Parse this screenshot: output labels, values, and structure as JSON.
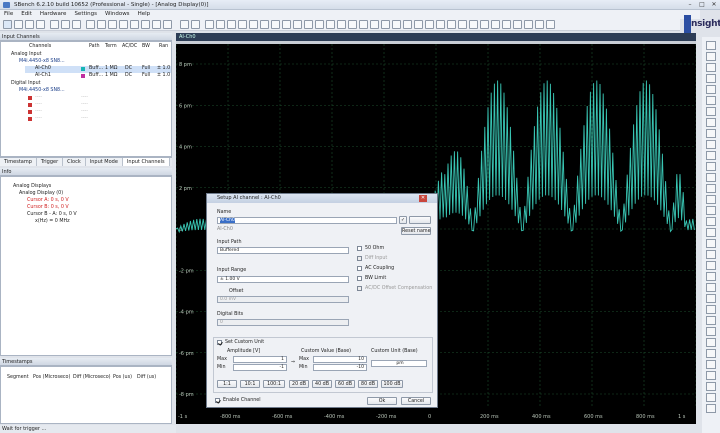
{
  "window": {
    "title": "SBench 6.2.10 build 10652 (Professional - Single) - [Analog Display(0)]",
    "min": "–",
    "max": "□",
    "close": "✕"
  },
  "menu": [
    "File",
    "Edit",
    "Hardware",
    "Settings",
    "Windows",
    "Help"
  ],
  "logo": {
    "text": "nsight"
  },
  "input_channels": {
    "header": "Input Channels",
    "columns": [
      "Channels",
      "Path",
      "Term",
      "AC/DC",
      "BW",
      "Ran"
    ],
    "rows": [
      {
        "name": "Analog Input"
      },
      {
        "name": "M4i.4450-x8 SN8..."
      },
      {
        "name": "AI-Ch0",
        "path": "Buff...",
        "term": "1 MΩ",
        "acdc": "DC",
        "bw": "Full",
        "range": "± 1.0"
      },
      {
        "name": "AI-Ch1",
        "path": "Buff...",
        "term": "1 MΩ",
        "acdc": "DC",
        "bw": "Full",
        "range": "± 1.0"
      },
      {
        "name": "Digital Input"
      },
      {
        "name": "M4i.4450-x8 SN8..."
      },
      {
        "name": "----",
        "dash": "----"
      },
      {
        "name": "----",
        "dash": "----"
      },
      {
        "name": "----",
        "dash": "----"
      },
      {
        "name": "----",
        "dash": "----"
      }
    ],
    "tabs": [
      "Timestamp",
      "Trigger",
      "Clock",
      "Input Mode",
      "Input Channels"
    ]
  },
  "info": {
    "header": "Info",
    "items": [
      "Analog Displays",
      "Analog Display (0)",
      "Cursor A: 0 s, 0 V",
      "Cursor B: 0 s, 0 V",
      "Cursor B - A: 0 s, 0 V",
      "x(Hz) = 0 MHz"
    ]
  },
  "timestamps": {
    "header": "Timestamps",
    "columns": [
      "Segment",
      "Pos (Microseco)",
      "Diff (Microseco)",
      "Pos (us)",
      "Diff (us)"
    ]
  },
  "status": "Wait for trigger ...",
  "plot": {
    "tab": "AI-Ch0",
    "y_ticks": [
      "8 pm",
      "6 pm",
      "4 pm",
      "2 pm",
      "0",
      "-2 pm",
      "-4 pm",
      "-6 pm",
      "-8 pm"
    ],
    "x_ticks": [
      "-1 s",
      "-800 ms",
      "-600 ms",
      "-400 ms",
      "-200 ms",
      "0",
      "200 ms",
      "400 ms",
      "600 ms",
      "800 ms",
      "1 s"
    ],
    "trace_color": "#39c6b4"
  },
  "dialog": {
    "title": "Setup AI channel : AI-Ch0",
    "name_label": "Name",
    "name_value": "AI-Ch0",
    "name_default": "AI-Ch0",
    "reset_name": "Reset name",
    "input_path_label": "Input Path",
    "input_path_value": "Buffered",
    "input_range_label": "Input Range",
    "input_range_value": "± 1.00 V",
    "offset_label": "Offset",
    "offset_value": "0.0 mV",
    "digital_bits_label": "Digital Bits",
    "digital_bits_value": "0",
    "ohm_label": "50 Ohm",
    "diff_label": "Diff Input",
    "ac_label": "AC Coupling",
    "bw_label": "BW Limit",
    "acdc_offset_label": "AC/DC Offset Compensation",
    "custom_unit_label": "Set Custom Unit",
    "amplitude_label": "Amplitude [V]",
    "custom_value_label": "Custom Value (Base)",
    "custom_unit_base_label": "Custom Unit (Base)",
    "max_label": "Max",
    "min_label": "Min",
    "amp_max": "1",
    "amp_min": "-1",
    "cv_max": "10",
    "cv_min": "-10",
    "arrow": "⇒",
    "unit_value": "pm",
    "scale_buttons": [
      "1:1",
      "10:1",
      "100:1",
      "20 dB",
      "40 dB",
      "60 dB",
      "80 dB",
      "100 dB"
    ],
    "enable_label": "Enable Channel",
    "ok": "Ok",
    "cancel": "Cancel"
  }
}
